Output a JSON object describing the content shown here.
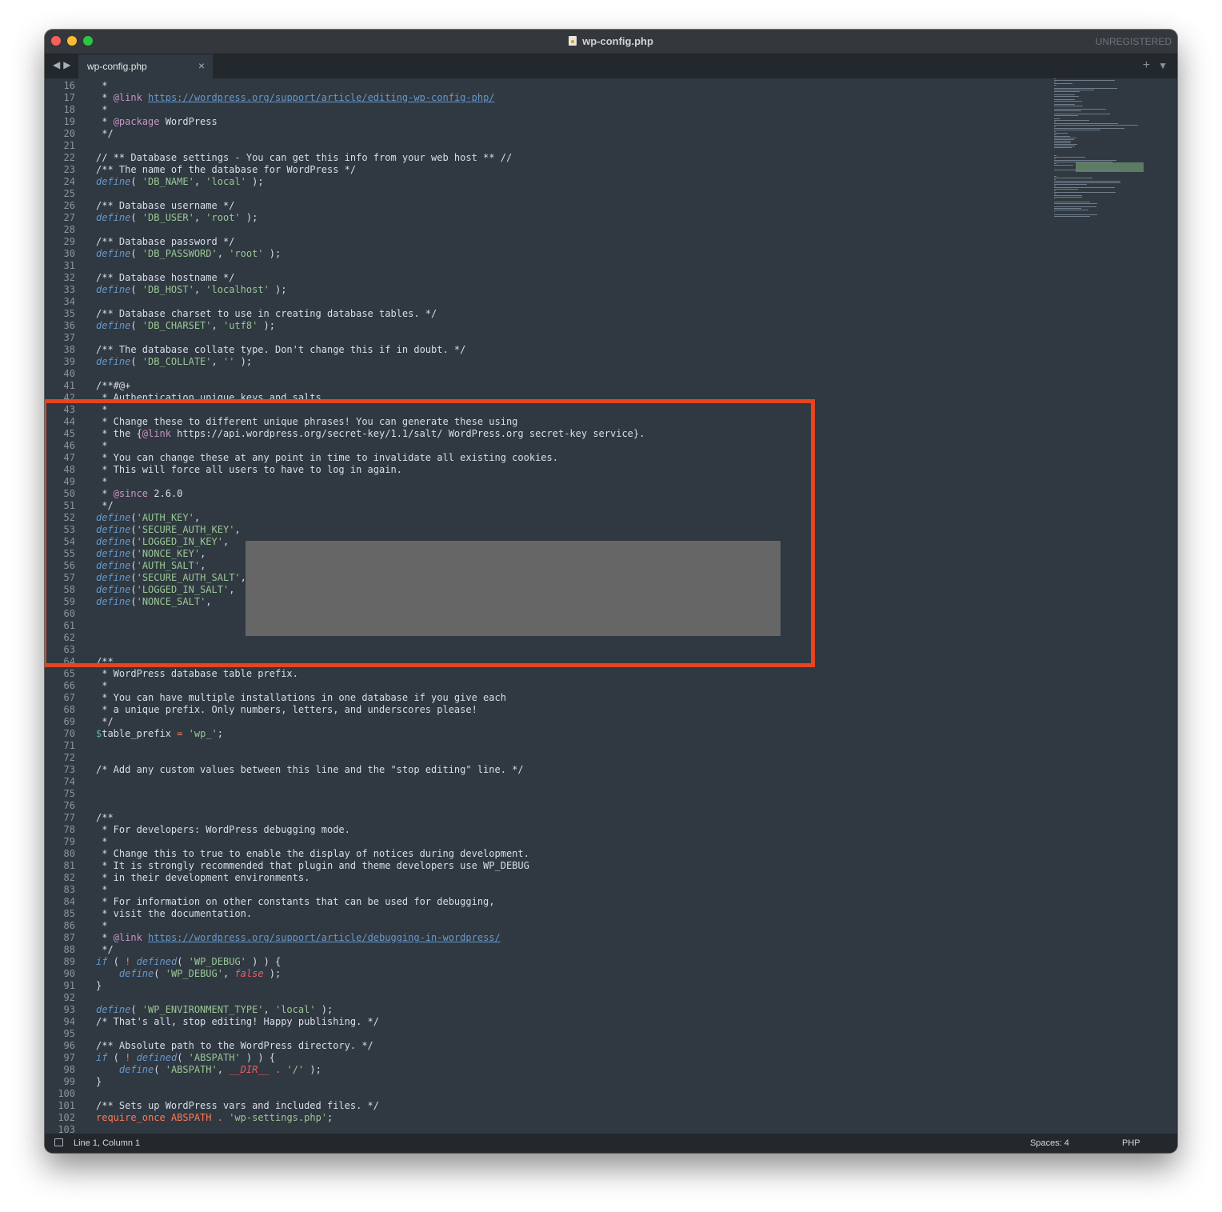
{
  "window": {
    "title": "wp-config.php",
    "registration": "UNREGISTERED",
    "traffic_lights": [
      "#fc5f57",
      "#fdbc2e",
      "#28c840"
    ]
  },
  "tabbar": {
    "nav_icons": [
      "back-arrow-icon",
      "forward-arrow-icon"
    ],
    "tab_label": "wp-config.php",
    "close_icon": "×",
    "new_tab_icon": "+",
    "menu_icon": "▼"
  },
  "statusbar": {
    "position": "Line 1, Column 1",
    "indentation": "Spaces: 4",
    "syntax": "PHP"
  },
  "colors": {
    "background": "#303841",
    "comment": "#d8dee9",
    "doc_tag": "#c594c5",
    "keyword": "#6699cc",
    "string": "#99c794",
    "highlight_border": "#e8441f",
    "redaction": "#666666"
  },
  "code_lines": [
    {
      "n": "16",
      "t": [
        {
          "s": " *",
          "c": "c-comment"
        }
      ]
    },
    {
      "n": "17",
      "t": [
        {
          "s": " * ",
          "c": "c-comment"
        },
        {
          "s": "@link",
          "c": "c-tag"
        },
        {
          "s": " ",
          "c": "c-comment"
        },
        {
          "s": "https://wordpress.org/support/article/editing-wp-config-php/",
          "c": "c-link"
        }
      ]
    },
    {
      "n": "18",
      "t": [
        {
          "s": " *",
          "c": "c-comment"
        }
      ]
    },
    {
      "n": "19",
      "t": [
        {
          "s": " * ",
          "c": "c-comment"
        },
        {
          "s": "@package",
          "c": "c-tag"
        },
        {
          "s": " WordPress",
          "c": "c-comment"
        }
      ]
    },
    {
      "n": "20",
      "t": [
        {
          "s": " */",
          "c": "c-comment"
        }
      ]
    },
    {
      "n": "21",
      "t": []
    },
    {
      "n": "22",
      "t": [
        {
          "s": "// ** Database settings - You can get this info from your web host ** //",
          "c": "c-comment"
        }
      ]
    },
    {
      "n": "23",
      "t": [
        {
          "s": "/** The name of the database for WordPress */",
          "c": "c-comment"
        }
      ]
    },
    {
      "n": "24",
      "t": [
        {
          "s": "define",
          "c": "c-kw"
        },
        {
          "s": "( ",
          "c": "c-pl"
        },
        {
          "s": "'DB_NAME'",
          "c": "c-str"
        },
        {
          "s": ", ",
          "c": "c-pl"
        },
        {
          "s": "'local'",
          "c": "c-str"
        },
        {
          "s": " );",
          "c": "c-pl"
        }
      ]
    },
    {
      "n": "25",
      "t": []
    },
    {
      "n": "26",
      "t": [
        {
          "s": "/** Database username */",
          "c": "c-comment"
        }
      ]
    },
    {
      "n": "27",
      "t": [
        {
          "s": "define",
          "c": "c-kw"
        },
        {
          "s": "( ",
          "c": "c-pl"
        },
        {
          "s": "'DB_USER'",
          "c": "c-str"
        },
        {
          "s": ", ",
          "c": "c-pl"
        },
        {
          "s": "'root'",
          "c": "c-str"
        },
        {
          "s": " );",
          "c": "c-pl"
        }
      ]
    },
    {
      "n": "28",
      "t": []
    },
    {
      "n": "29",
      "t": [
        {
          "s": "/** Database password */",
          "c": "c-comment"
        }
      ]
    },
    {
      "n": "30",
      "t": [
        {
          "s": "define",
          "c": "c-kw"
        },
        {
          "s": "( ",
          "c": "c-pl"
        },
        {
          "s": "'DB_PASSWORD'",
          "c": "c-str"
        },
        {
          "s": ", ",
          "c": "c-pl"
        },
        {
          "s": "'root'",
          "c": "c-str"
        },
        {
          "s": " );",
          "c": "c-pl"
        }
      ]
    },
    {
      "n": "31",
      "t": []
    },
    {
      "n": "32",
      "t": [
        {
          "s": "/** Database hostname */",
          "c": "c-comment"
        }
      ]
    },
    {
      "n": "33",
      "t": [
        {
          "s": "define",
          "c": "c-kw"
        },
        {
          "s": "( ",
          "c": "c-pl"
        },
        {
          "s": "'DB_HOST'",
          "c": "c-str"
        },
        {
          "s": ", ",
          "c": "c-pl"
        },
        {
          "s": "'localhost'",
          "c": "c-str"
        },
        {
          "s": " );",
          "c": "c-pl"
        }
      ]
    },
    {
      "n": "34",
      "t": []
    },
    {
      "n": "35",
      "t": [
        {
          "s": "/** Database charset to use in creating database tables. */",
          "c": "c-comment"
        }
      ]
    },
    {
      "n": "36",
      "t": [
        {
          "s": "define",
          "c": "c-kw"
        },
        {
          "s": "( ",
          "c": "c-pl"
        },
        {
          "s": "'DB_CHARSET'",
          "c": "c-str"
        },
        {
          "s": ", ",
          "c": "c-pl"
        },
        {
          "s": "'utf8'",
          "c": "c-str"
        },
        {
          "s": " );",
          "c": "c-pl"
        }
      ]
    },
    {
      "n": "37",
      "t": []
    },
    {
      "n": "38",
      "t": [
        {
          "s": "/** The database collate type. Don't change this if in doubt. */",
          "c": "c-comment"
        }
      ]
    },
    {
      "n": "39",
      "t": [
        {
          "s": "define",
          "c": "c-kw"
        },
        {
          "s": "( ",
          "c": "c-pl"
        },
        {
          "s": "'DB_COLLATE'",
          "c": "c-str"
        },
        {
          "s": ", ",
          "c": "c-pl"
        },
        {
          "s": "''",
          "c": "c-str"
        },
        {
          "s": " );",
          "c": "c-pl"
        }
      ]
    },
    {
      "n": "40",
      "t": []
    },
    {
      "n": "41",
      "t": [
        {
          "s": "/**#@+",
          "c": "c-comment"
        }
      ]
    },
    {
      "n": "42",
      "t": [
        {
          "s": " * Authentication unique keys and salts.",
          "c": "c-comment"
        }
      ]
    },
    {
      "n": "43",
      "t": [
        {
          "s": " *",
          "c": "c-comment"
        }
      ]
    },
    {
      "n": "44",
      "t": [
        {
          "s": " * Change these to different unique phrases! You can generate these using",
          "c": "c-comment"
        }
      ]
    },
    {
      "n": "45",
      "t": [
        {
          "s": " * the {",
          "c": "c-comment"
        },
        {
          "s": "@link",
          "c": "c-tag"
        },
        {
          "s": " https://api.wordpress.org/secret-key/1.1/salt/ WordPress.org secret-key service}.",
          "c": "c-comment"
        }
      ]
    },
    {
      "n": "46",
      "t": [
        {
          "s": " *",
          "c": "c-comment"
        }
      ]
    },
    {
      "n": "47",
      "t": [
        {
          "s": " * You can change these at any point in time to invalidate all existing cookies.",
          "c": "c-comment"
        }
      ]
    },
    {
      "n": "48",
      "t": [
        {
          "s": " * This will force all users to have to log in again.",
          "c": "c-comment"
        }
      ]
    },
    {
      "n": "49",
      "t": [
        {
          "s": " *",
          "c": "c-comment"
        }
      ]
    },
    {
      "n": "50",
      "t": [
        {
          "s": " * ",
          "c": "c-comment"
        },
        {
          "s": "@since",
          "c": "c-tag"
        },
        {
          "s": " 2.6.0",
          "c": "c-comment"
        }
      ]
    },
    {
      "n": "51",
      "t": [
        {
          "s": " */",
          "c": "c-comment"
        }
      ]
    },
    {
      "n": "52",
      "t": [
        {
          "s": "define",
          "c": "c-kw"
        },
        {
          "s": "(",
          "c": "c-pl"
        },
        {
          "s": "'AUTH_KEY'",
          "c": "c-str"
        },
        {
          "s": ",",
          "c": "c-pl"
        }
      ]
    },
    {
      "n": "53",
      "t": [
        {
          "s": "define",
          "c": "c-kw"
        },
        {
          "s": "(",
          "c": "c-pl"
        },
        {
          "s": "'SECURE_AUTH_KEY'",
          "c": "c-str"
        },
        {
          "s": ",",
          "c": "c-pl"
        }
      ]
    },
    {
      "n": "54",
      "t": [
        {
          "s": "define",
          "c": "c-kw"
        },
        {
          "s": "(",
          "c": "c-pl"
        },
        {
          "s": "'LOGGED_IN_KEY'",
          "c": "c-str"
        },
        {
          "s": ",",
          "c": "c-pl"
        }
      ]
    },
    {
      "n": "55",
      "t": [
        {
          "s": "define",
          "c": "c-kw"
        },
        {
          "s": "(",
          "c": "c-pl"
        },
        {
          "s": "'NONCE_KEY'",
          "c": "c-str"
        },
        {
          "s": ",",
          "c": "c-pl"
        }
      ]
    },
    {
      "n": "56",
      "t": [
        {
          "s": "define",
          "c": "c-kw"
        },
        {
          "s": "(",
          "c": "c-pl"
        },
        {
          "s": "'AUTH_SALT'",
          "c": "c-str"
        },
        {
          "s": ",",
          "c": "c-pl"
        }
      ]
    },
    {
      "n": "57",
      "t": [
        {
          "s": "define",
          "c": "c-kw"
        },
        {
          "s": "(",
          "c": "c-pl"
        },
        {
          "s": "'SECURE_AUTH_SALT'",
          "c": "c-str"
        },
        {
          "s": ",",
          "c": "c-pl"
        }
      ]
    },
    {
      "n": "58",
      "t": [
        {
          "s": "define",
          "c": "c-kw"
        },
        {
          "s": "(",
          "c": "c-pl"
        },
        {
          "s": "'LOGGED_IN_SALT'",
          "c": "c-str"
        },
        {
          "s": ",",
          "c": "c-pl"
        }
      ]
    },
    {
      "n": "59",
      "t": [
        {
          "s": "define",
          "c": "c-kw"
        },
        {
          "s": "(",
          "c": "c-pl"
        },
        {
          "s": "'NONCE_SALT'",
          "c": "c-str"
        },
        {
          "s": ",",
          "c": "c-pl"
        }
      ]
    },
    {
      "n": "60",
      "t": []
    },
    {
      "n": "61",
      "t": []
    },
    {
      "n": "62",
      "t": []
    },
    {
      "n": "63",
      "t": []
    },
    {
      "n": "64",
      "t": [
        {
          "s": "/**",
          "c": "c-comment"
        }
      ]
    },
    {
      "n": "65",
      "t": [
        {
          "s": " * WordPress database table prefix.",
          "c": "c-comment"
        }
      ]
    },
    {
      "n": "66",
      "t": [
        {
          "s": " *",
          "c": "c-comment"
        }
      ]
    },
    {
      "n": "67",
      "t": [
        {
          "s": " * You can have multiple installations in one database if you give each",
          "c": "c-comment"
        }
      ]
    },
    {
      "n": "68",
      "t": [
        {
          "s": " * a unique prefix. Only numbers, letters, and underscores please!",
          "c": "c-comment"
        }
      ]
    },
    {
      "n": "69",
      "t": [
        {
          "s": " */",
          "c": "c-comment"
        }
      ]
    },
    {
      "n": "70",
      "t": [
        {
          "s": "$",
          "c": "c-var"
        },
        {
          "s": "table_prefix ",
          "c": "c-pl"
        },
        {
          "s": "=",
          "c": "c-op"
        },
        {
          "s": " ",
          "c": "c-pl"
        },
        {
          "s": "'wp_'",
          "c": "c-str"
        },
        {
          "s": ";",
          "c": "c-pl"
        }
      ]
    },
    {
      "n": "71",
      "t": []
    },
    {
      "n": "72",
      "t": []
    },
    {
      "n": "73",
      "t": [
        {
          "s": "/* Add any custom values between this line and the \"stop editing\" line. */",
          "c": "c-comment"
        }
      ]
    },
    {
      "n": "74",
      "t": []
    },
    {
      "n": "75",
      "t": []
    },
    {
      "n": "76",
      "t": []
    },
    {
      "n": "77",
      "t": [
        {
          "s": "/**",
          "c": "c-comment"
        }
      ]
    },
    {
      "n": "78",
      "t": [
        {
          "s": " * For developers: WordPress debugging mode.",
          "c": "c-comment"
        }
      ]
    },
    {
      "n": "79",
      "t": [
        {
          "s": " *",
          "c": "c-comment"
        }
      ]
    },
    {
      "n": "80",
      "t": [
        {
          "s": " * Change this to true to enable the display of notices during development.",
          "c": "c-comment"
        }
      ]
    },
    {
      "n": "81",
      "t": [
        {
          "s": " * It is strongly recommended that plugin and theme developers use WP_DEBUG",
          "c": "c-comment"
        }
      ]
    },
    {
      "n": "82",
      "t": [
        {
          "s": " * in their development environments.",
          "c": "c-comment"
        }
      ]
    },
    {
      "n": "83",
      "t": [
        {
          "s": " *",
          "c": "c-comment"
        }
      ]
    },
    {
      "n": "84",
      "t": [
        {
          "s": " * For information on other constants that can be used for debugging,",
          "c": "c-comment"
        }
      ]
    },
    {
      "n": "85",
      "t": [
        {
          "s": " * visit the documentation.",
          "c": "c-comment"
        }
      ]
    },
    {
      "n": "86",
      "t": [
        {
          "s": " *",
          "c": "c-comment"
        }
      ]
    },
    {
      "n": "87",
      "t": [
        {
          "s": " * ",
          "c": "c-comment"
        },
        {
          "s": "@link",
          "c": "c-tag"
        },
        {
          "s": " ",
          "c": "c-comment"
        },
        {
          "s": "https://wordpress.org/support/article/debugging-in-wordpress/",
          "c": "c-link"
        }
      ]
    },
    {
      "n": "88",
      "t": [
        {
          "s": " */",
          "c": "c-comment"
        }
      ]
    },
    {
      "n": "89",
      "t": [
        {
          "s": "if",
          "c": "c-kw"
        },
        {
          "s": " ( ",
          "c": "c-pl"
        },
        {
          "s": "!",
          "c": "c-op"
        },
        {
          "s": " ",
          "c": "c-pl"
        },
        {
          "s": "defined",
          "c": "c-kw"
        },
        {
          "s": "( ",
          "c": "c-pl"
        },
        {
          "s": "'WP_DEBUG'",
          "c": "c-str"
        },
        {
          "s": " ) ) {",
          "c": "c-pl"
        }
      ]
    },
    {
      "n": "90",
      "t": [
        {
          "s": "    ",
          "c": "c-pl"
        },
        {
          "s": "define",
          "c": "c-kw"
        },
        {
          "s": "( ",
          "c": "c-pl"
        },
        {
          "s": "'WP_DEBUG'",
          "c": "c-str"
        },
        {
          "s": ", ",
          "c": "c-pl"
        },
        {
          "s": "false",
          "c": "c-bool"
        },
        {
          "s": " );",
          "c": "c-pl"
        }
      ]
    },
    {
      "n": "91",
      "t": [
        {
          "s": "}",
          "c": "c-pl"
        }
      ]
    },
    {
      "n": "92",
      "t": []
    },
    {
      "n": "93",
      "t": [
        {
          "s": "define",
          "c": "c-kw"
        },
        {
          "s": "( ",
          "c": "c-pl"
        },
        {
          "s": "'WP_ENVIRONMENT_TYPE'",
          "c": "c-str"
        },
        {
          "s": ", ",
          "c": "c-pl"
        },
        {
          "s": "'local'",
          "c": "c-str"
        },
        {
          "s": " );",
          "c": "c-pl"
        }
      ]
    },
    {
      "n": "94",
      "t": [
        {
          "s": "/* That's all, stop editing! Happy publishing. */",
          "c": "c-comment"
        }
      ]
    },
    {
      "n": "95",
      "t": []
    },
    {
      "n": "96",
      "t": [
        {
          "s": "/** Absolute path to the WordPress directory. */",
          "c": "c-comment"
        }
      ]
    },
    {
      "n": "97",
      "t": [
        {
          "s": "if",
          "c": "c-kw"
        },
        {
          "s": " ( ",
          "c": "c-pl"
        },
        {
          "s": "!",
          "c": "c-op"
        },
        {
          "s": " ",
          "c": "c-pl"
        },
        {
          "s": "defined",
          "c": "c-kw"
        },
        {
          "s": "( ",
          "c": "c-pl"
        },
        {
          "s": "'ABSPATH'",
          "c": "c-str"
        },
        {
          "s": " ) ) {",
          "c": "c-pl"
        }
      ]
    },
    {
      "n": "98",
      "t": [
        {
          "s": "    ",
          "c": "c-pl"
        },
        {
          "s": "define",
          "c": "c-kw"
        },
        {
          "s": "( ",
          "c": "c-pl"
        },
        {
          "s": "'ABSPATH'",
          "c": "c-str"
        },
        {
          "s": ", ",
          "c": "c-pl"
        },
        {
          "s": "__DIR__",
          "c": "c-bool"
        },
        {
          "s": " ",
          "c": "c-pl"
        },
        {
          "s": ".",
          "c": "c-op"
        },
        {
          "s": " ",
          "c": "c-pl"
        },
        {
          "s": "'/'",
          "c": "c-str"
        },
        {
          "s": " );",
          "c": "c-pl"
        }
      ]
    },
    {
      "n": "99",
      "t": [
        {
          "s": "}",
          "c": "c-pl"
        }
      ]
    },
    {
      "n": "100",
      "t": []
    },
    {
      "n": "101",
      "t": [
        {
          "s": "/** Sets up WordPress vars and included files. */",
          "c": "c-comment"
        }
      ]
    },
    {
      "n": "102",
      "t": [
        {
          "s": "require_once",
          "c": "c-op"
        },
        {
          "s": " ABSPATH ",
          "c": "c-op"
        },
        {
          "s": ".",
          "c": "c-op"
        },
        {
          "s": " ",
          "c": "c-pl"
        },
        {
          "s": "'wp-settings.php'",
          "c": "c-str"
        },
        {
          "s": ";",
          "c": "c-pl"
        }
      ]
    },
    {
      "n": "103",
      "t": []
    }
  ]
}
